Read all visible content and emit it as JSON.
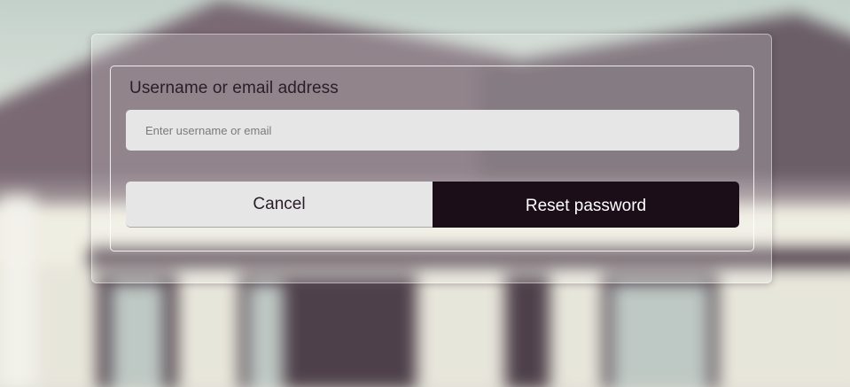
{
  "form": {
    "field_label": "Username or email address",
    "input_value": "",
    "input_placeholder": "Enter username or email",
    "cancel_label": "Cancel",
    "reset_label": "Reset password"
  },
  "colors": {
    "primary_button": "#1b0e18",
    "secondary_button": "#e6e6e6",
    "input_background": "#e6e6e6"
  }
}
